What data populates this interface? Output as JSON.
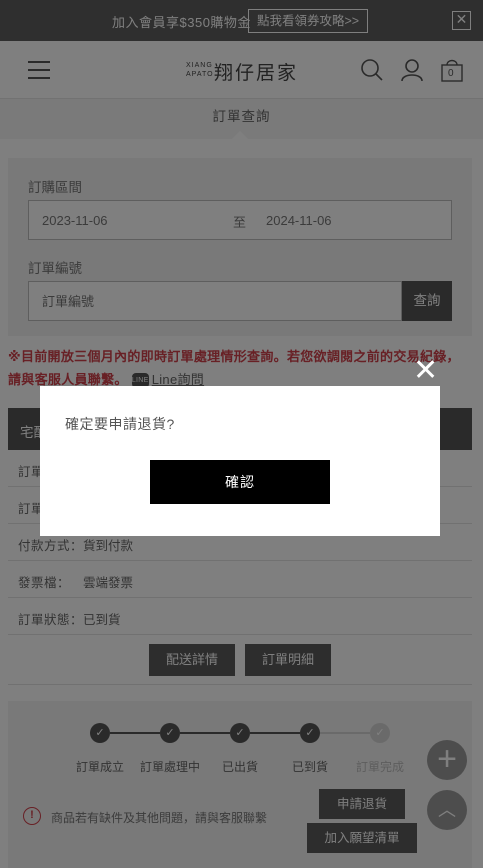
{
  "promo": {
    "text": "加入會員享$350購物金",
    "button": "點我看領券攻略>>",
    "close": "✕"
  },
  "header": {
    "logo_small_1": "XIANG",
    "logo_small_2": "APATO",
    "logo": "翔仔居家",
    "icons": [
      "menu-icon",
      "search-icon",
      "user-icon",
      "cart-icon"
    ],
    "cart_count": "0"
  },
  "page": {
    "subtitle": "訂單查詢"
  },
  "search": {
    "period_label": "訂購區間",
    "date_from": "2023-11-06",
    "date_sep": "至",
    "date_to": "2024-11-06",
    "order_no_label": "訂單編號",
    "order_no_placeholder": "訂單編號",
    "query_button": "查詢"
  },
  "notice": {
    "text": "※目前開放三個月內的即時訂單處理情形查詢。若您欲調閱之前的交易紀錄，請與客服人員聯繫。",
    "line_badge": "LINE",
    "line_link": "Line詢問"
  },
  "order": {
    "header": "宅配",
    "rows": [
      {
        "key": "訂單",
        "value": ""
      },
      {
        "key": "訂單",
        "value": ""
      },
      {
        "key": "付款方式：",
        "value": "貨到付款"
      },
      {
        "key": "發票檔：",
        "value": "雲端發票"
      },
      {
        "key": "訂單狀態：",
        "value": "已到貨"
      }
    ],
    "delivery_button": "配送詳情",
    "detail_button": "訂單明細"
  },
  "progress": {
    "steps": [
      {
        "label": "訂單成立",
        "done": true
      },
      {
        "label": "訂單處理中",
        "done": true
      },
      {
        "label": "已出貨",
        "done": true
      },
      {
        "label": "已到貨",
        "done": true
      },
      {
        "label": "訂單完成",
        "done": false
      }
    ],
    "check": "✓",
    "warning_icon": "!",
    "warning_text": "商品若有缺件及其他問題，請與客服聯繫",
    "return_button": "申請退貨",
    "wishlist_button": "加入願望清單"
  },
  "fab": {
    "plus": "+",
    "up": "︿"
  },
  "modal": {
    "close": "✕",
    "message": "確定要申請退貨?",
    "confirm_button": "確認"
  }
}
